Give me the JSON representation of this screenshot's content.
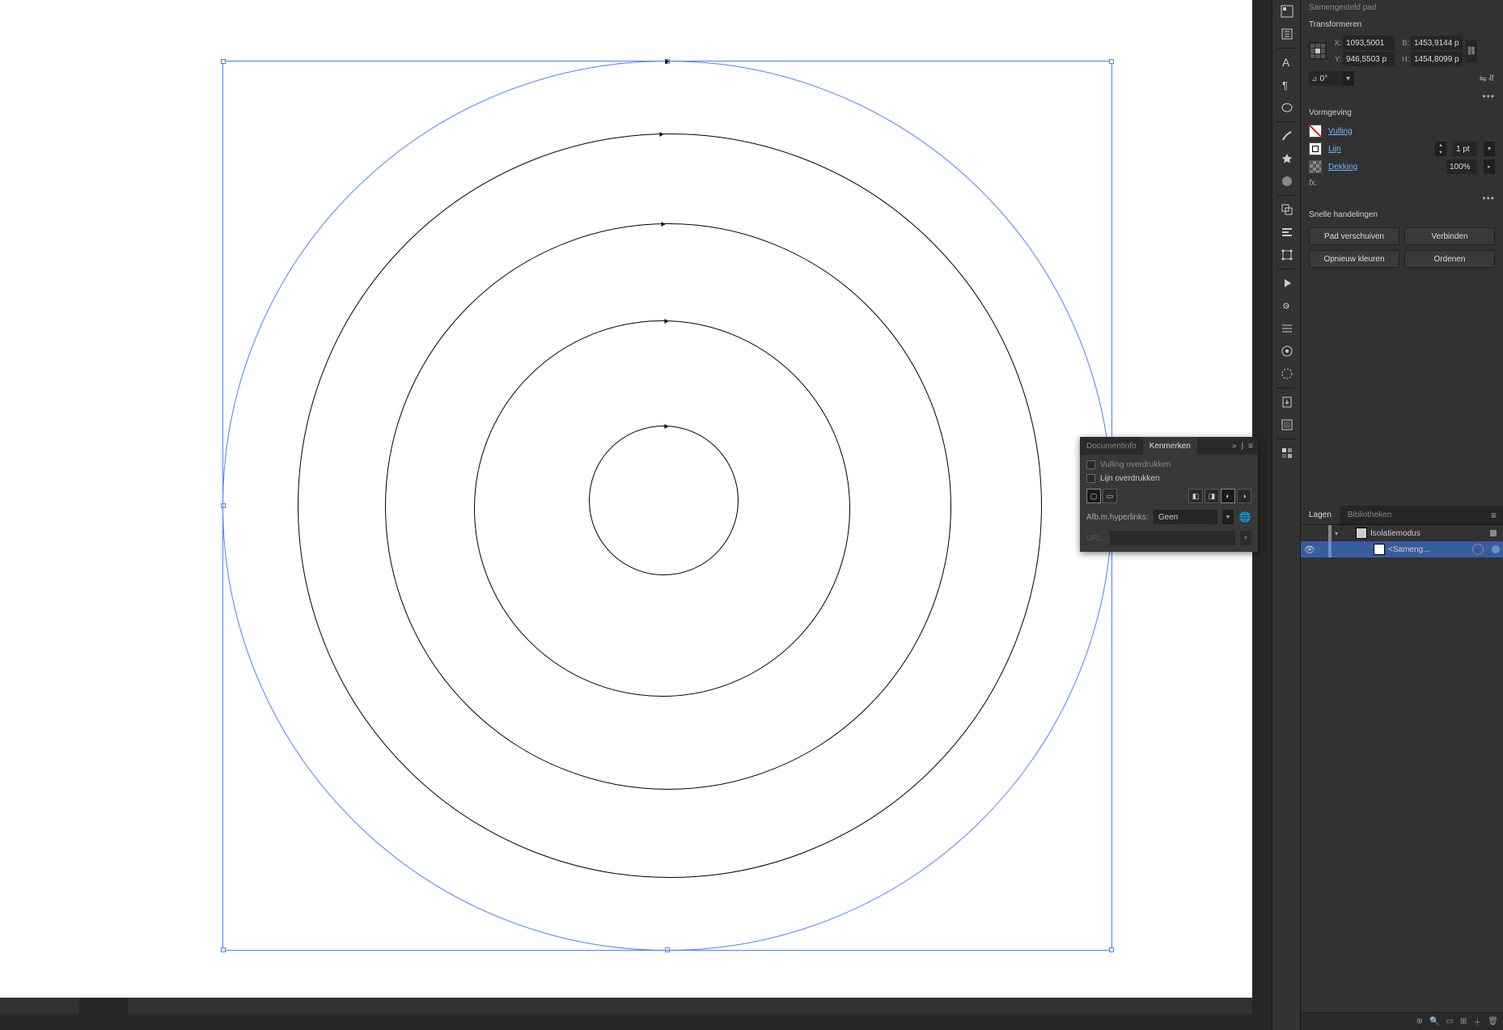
{
  "properties": {
    "object_type": "Samengesteld pad",
    "transform_title": "Transformeren",
    "x_label": "X:",
    "x_value": "1093,5001",
    "y_label": "Y:",
    "y_value": "946,5503 p",
    "w_label": "B:",
    "w_value": "1453,9144 p",
    "h_label": "H:",
    "h_value": "1454,8099 p",
    "angle": "0°"
  },
  "appearance": {
    "title": "Vormgeving",
    "fill_label": "Vulling",
    "stroke_label": "Lijn",
    "stroke_value": "1 pt",
    "opacity_label": "Dekking",
    "opacity_value": "100%",
    "fx": "fx."
  },
  "quick_actions": {
    "title": "Snelle handelingen",
    "buttons": [
      "Pad verschuiven",
      "Verbinden",
      "Opnieuw kleuren",
      "Ordenen"
    ]
  },
  "layers": {
    "tabs": [
      "Lagen",
      "Bibliotheken"
    ],
    "isolation": "Isolatiemodus",
    "item": "<Sameng..."
  },
  "attributes_panel": {
    "tabs": [
      "Documentinfo",
      "Kenmerken"
    ],
    "overprint_fill": "Vulling overdrukken",
    "overprint_stroke": "Lijn overdrukken",
    "hyperlink_label": "Afb.m.hyperlinks:",
    "hyperlink_value": "Geen",
    "url_label": "URL:"
  }
}
